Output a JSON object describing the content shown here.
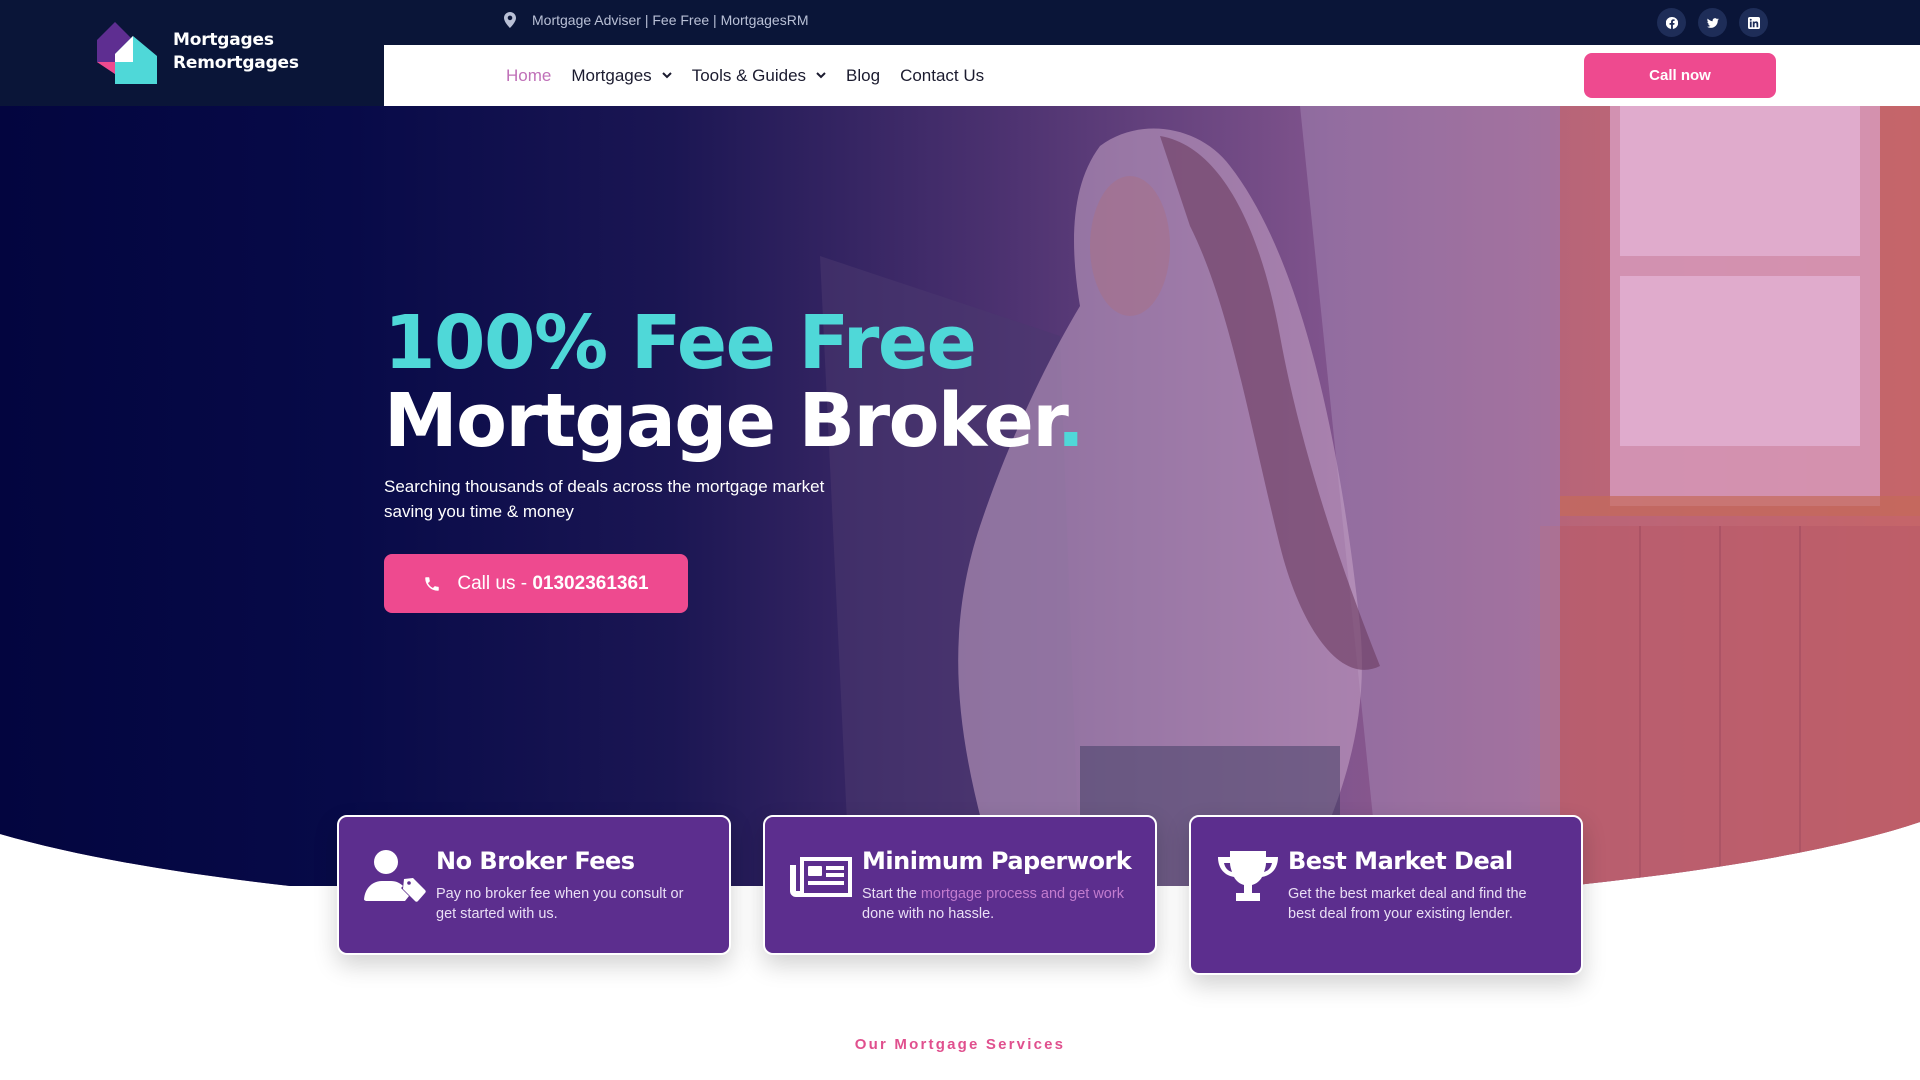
{
  "brand": {
    "name_line1": "Mortgages",
    "name_line2": "Remortgages",
    "colors": {
      "navy": "#0a1538",
      "purple": "#5c2e8e",
      "teal": "#4fd8d8",
      "pink": "#ee4a8f"
    }
  },
  "topbar": {
    "location_icon": "map-pin-icon",
    "tagline": "Mortgage Adviser | Fee Free | MortgagesRM",
    "socials": [
      {
        "name": "facebook",
        "icon": "facebook-icon"
      },
      {
        "name": "twitter",
        "icon": "twitter-icon"
      },
      {
        "name": "linkedin",
        "icon": "linkedin-icon"
      }
    ]
  },
  "nav": {
    "items": [
      {
        "label": "Home",
        "active": true,
        "dropdown": false
      },
      {
        "label": "Mortgages",
        "active": false,
        "dropdown": true
      },
      {
        "label": "Tools & Guides",
        "active": false,
        "dropdown": true
      },
      {
        "label": "Blog",
        "active": false,
        "dropdown": false
      },
      {
        "label": "Contact Us",
        "active": false,
        "dropdown": false
      }
    ],
    "cta_label": "Call now"
  },
  "hero": {
    "title_line1": "100% Fee Free",
    "title_line2": "Mortgage Broker",
    "title_dot": ".",
    "subtitle_line1": "Searching thousands of deals across the mortgage market",
    "subtitle_line2": "saving you time & money",
    "cta_prefix": "Call us - ",
    "cta_phone": "01302361361",
    "cta_icon": "phone-icon"
  },
  "features": [
    {
      "icon": "user-tag-icon",
      "title": "No Broker Fees",
      "text": "Pay no broker fee when you consult or get started with us."
    },
    {
      "icon": "newspaper-icon",
      "title": "Minimum Paperwork",
      "text_before": "Start the ",
      "text_link": "mortgage process and get work",
      "text_after": " done with no hassle."
    },
    {
      "icon": "trophy-icon",
      "title": "Best Market Deal",
      "text": "Get the best market deal and find the best deal from your existing lender."
    }
  ],
  "services": {
    "label": "Our Mortgage Services"
  }
}
